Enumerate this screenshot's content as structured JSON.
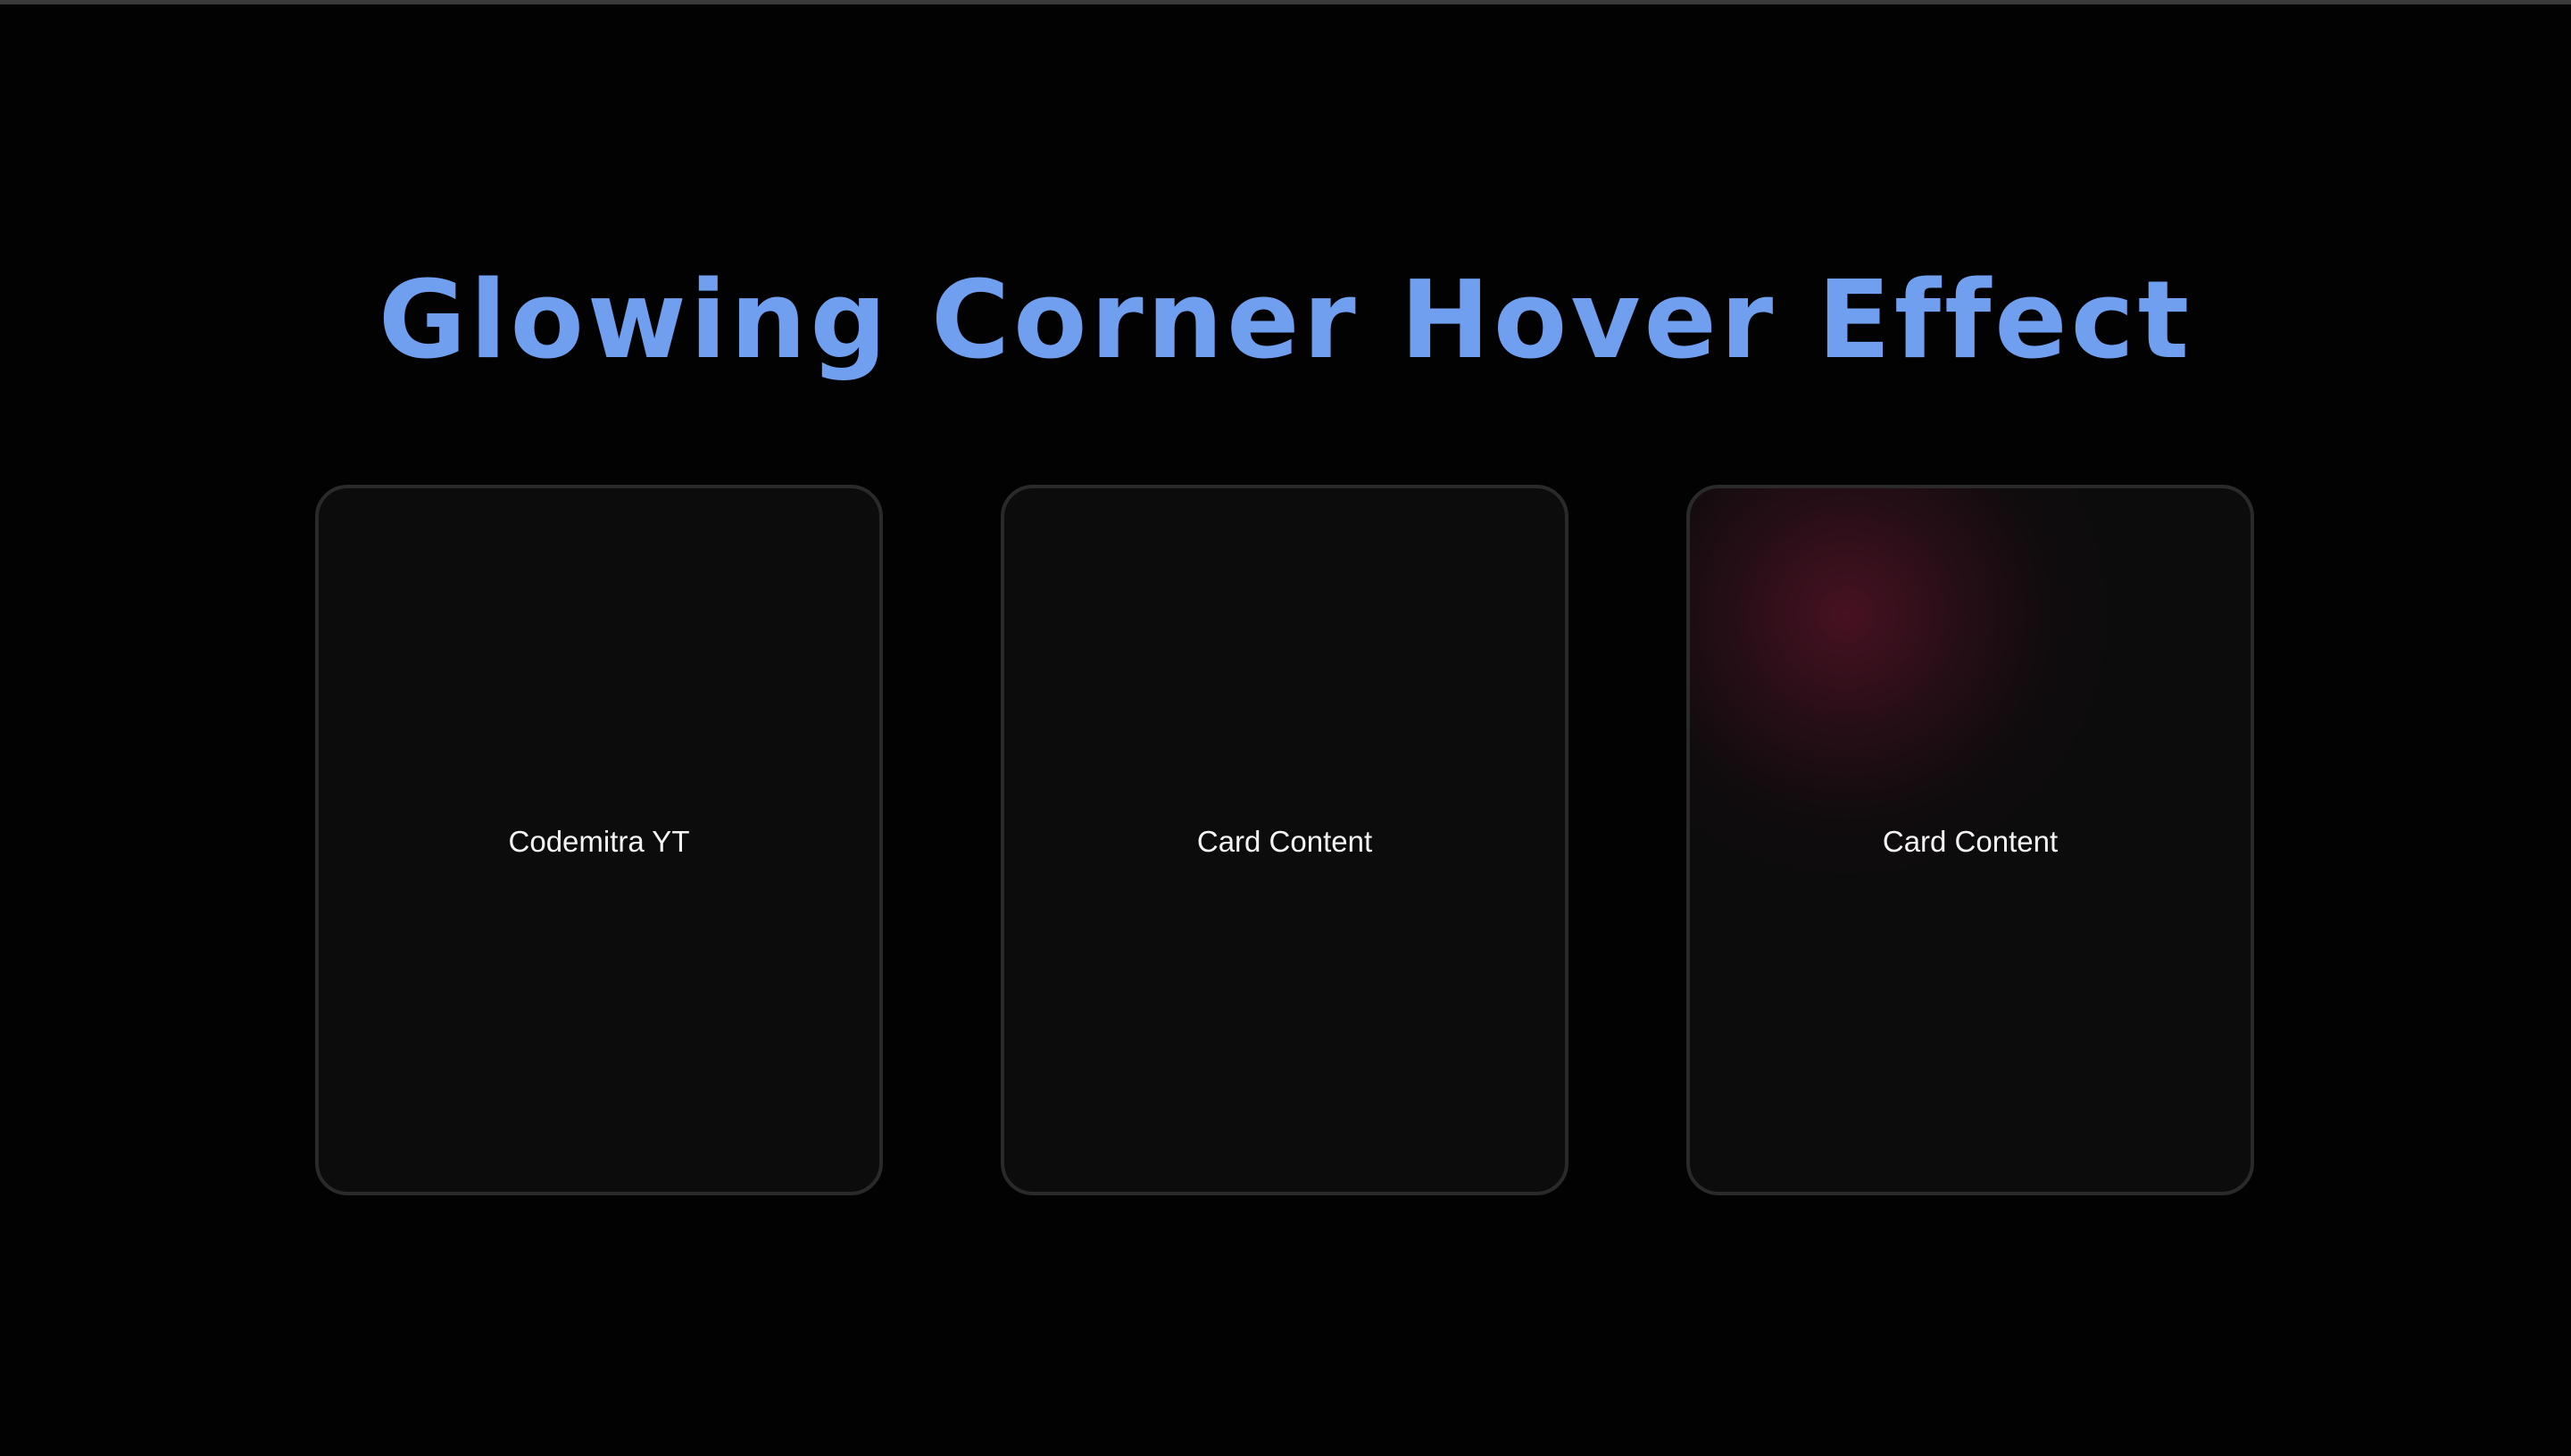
{
  "page": {
    "title": "Glowing Corner Hover Effect"
  },
  "cards": [
    {
      "label": "Codemitra YT",
      "hovered": false
    },
    {
      "label": "Card Content",
      "hovered": false
    },
    {
      "label": "Card Content",
      "hovered": true
    }
  ],
  "colors": {
    "background": "#020202",
    "title": "#6f9fee",
    "card_background": "#0c0c0c",
    "card_border": "#2a2a2a",
    "glow": "#78163a",
    "card_text": "#f4f4f4"
  }
}
